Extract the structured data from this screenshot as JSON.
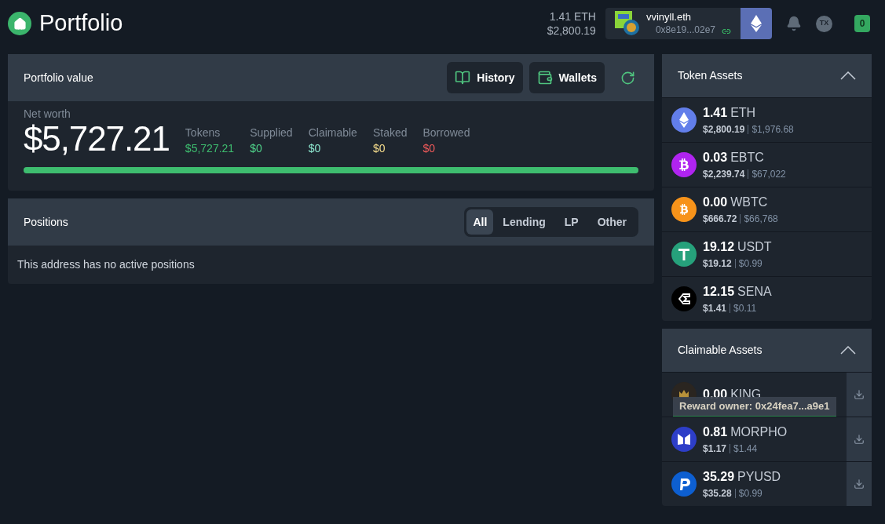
{
  "header": {
    "title": "Portfolio",
    "balance_eth": "1.41 ETH",
    "balance_usd": "$2,800.19",
    "account": {
      "name": "vvinyll.eth",
      "address": "0x8e19...02e7"
    },
    "tx_badge": "TX",
    "gas_count": "0"
  },
  "portfolio_value": {
    "title": "Portfolio value",
    "buttons": [
      {
        "kind": "history",
        "label": "History"
      },
      {
        "kind": "wallets",
        "label": "Wallets"
      }
    ],
    "net_worth_label": "Net worth",
    "net_worth": "$5,727.21",
    "breakdown": [
      {
        "label": "Tokens",
        "value": "$5,727.21",
        "color": "#3ebd6f"
      },
      {
        "label": "Supplied",
        "value": "$0",
        "color": "#4fd28a"
      },
      {
        "label": "Claimable",
        "value": "$0",
        "color": "#8ee8d0"
      },
      {
        "label": "Staked",
        "value": "$0",
        "color": "#f5dc8c"
      },
      {
        "label": "Borrowed",
        "value": "$0",
        "color": "#f05a5a"
      }
    ],
    "bar": {
      "level": 1
    }
  },
  "positions": {
    "title": "Positions",
    "tabs": [
      {
        "label": "All",
        "selected": true
      },
      {
        "label": "Lending",
        "selected": false
      },
      {
        "label": "LP",
        "selected": false
      },
      {
        "label": "Other",
        "selected": false
      }
    ],
    "empty_message": "This address has no active positions"
  },
  "token_assets": {
    "title": "Token Assets",
    "expanded": true,
    "items": [
      {
        "kind": "eth",
        "amount": "1.41",
        "symbol": "ETH",
        "value": "$2,800.19",
        "price": "$1,976.68"
      },
      {
        "kind": "ebtc",
        "amount": "0.03",
        "symbol": "EBTC",
        "value": "$2,239.74",
        "price": "$67,022"
      },
      {
        "kind": "wbtc",
        "amount": "0.00",
        "symbol": "WBTC",
        "value": "$666.72",
        "price": "$66,768"
      },
      {
        "kind": "usdt",
        "amount": "19.12",
        "symbol": "USDT",
        "value": "$19.12",
        "price": "$0.99"
      },
      {
        "kind": "sena",
        "amount": "12.15",
        "symbol": "SENA",
        "value": "$1.41",
        "price": "$0.11"
      }
    ]
  },
  "claimable_assets": {
    "title": "Claimable Assets",
    "expanded": true,
    "items": [
      {
        "kind": "king",
        "amount": "0.00",
        "symbol": "KING",
        "tooltip": "Reward owner: 0x24fea7...a9e1"
      },
      {
        "kind": "morpho",
        "amount": "0.81",
        "symbol": "MORPHO",
        "value": "$1.17",
        "price": "$1.44"
      },
      {
        "kind": "pyusd",
        "amount": "35.29",
        "symbol": "PYUSD",
        "value": "$35.28",
        "price": "$0.99"
      }
    ]
  }
}
